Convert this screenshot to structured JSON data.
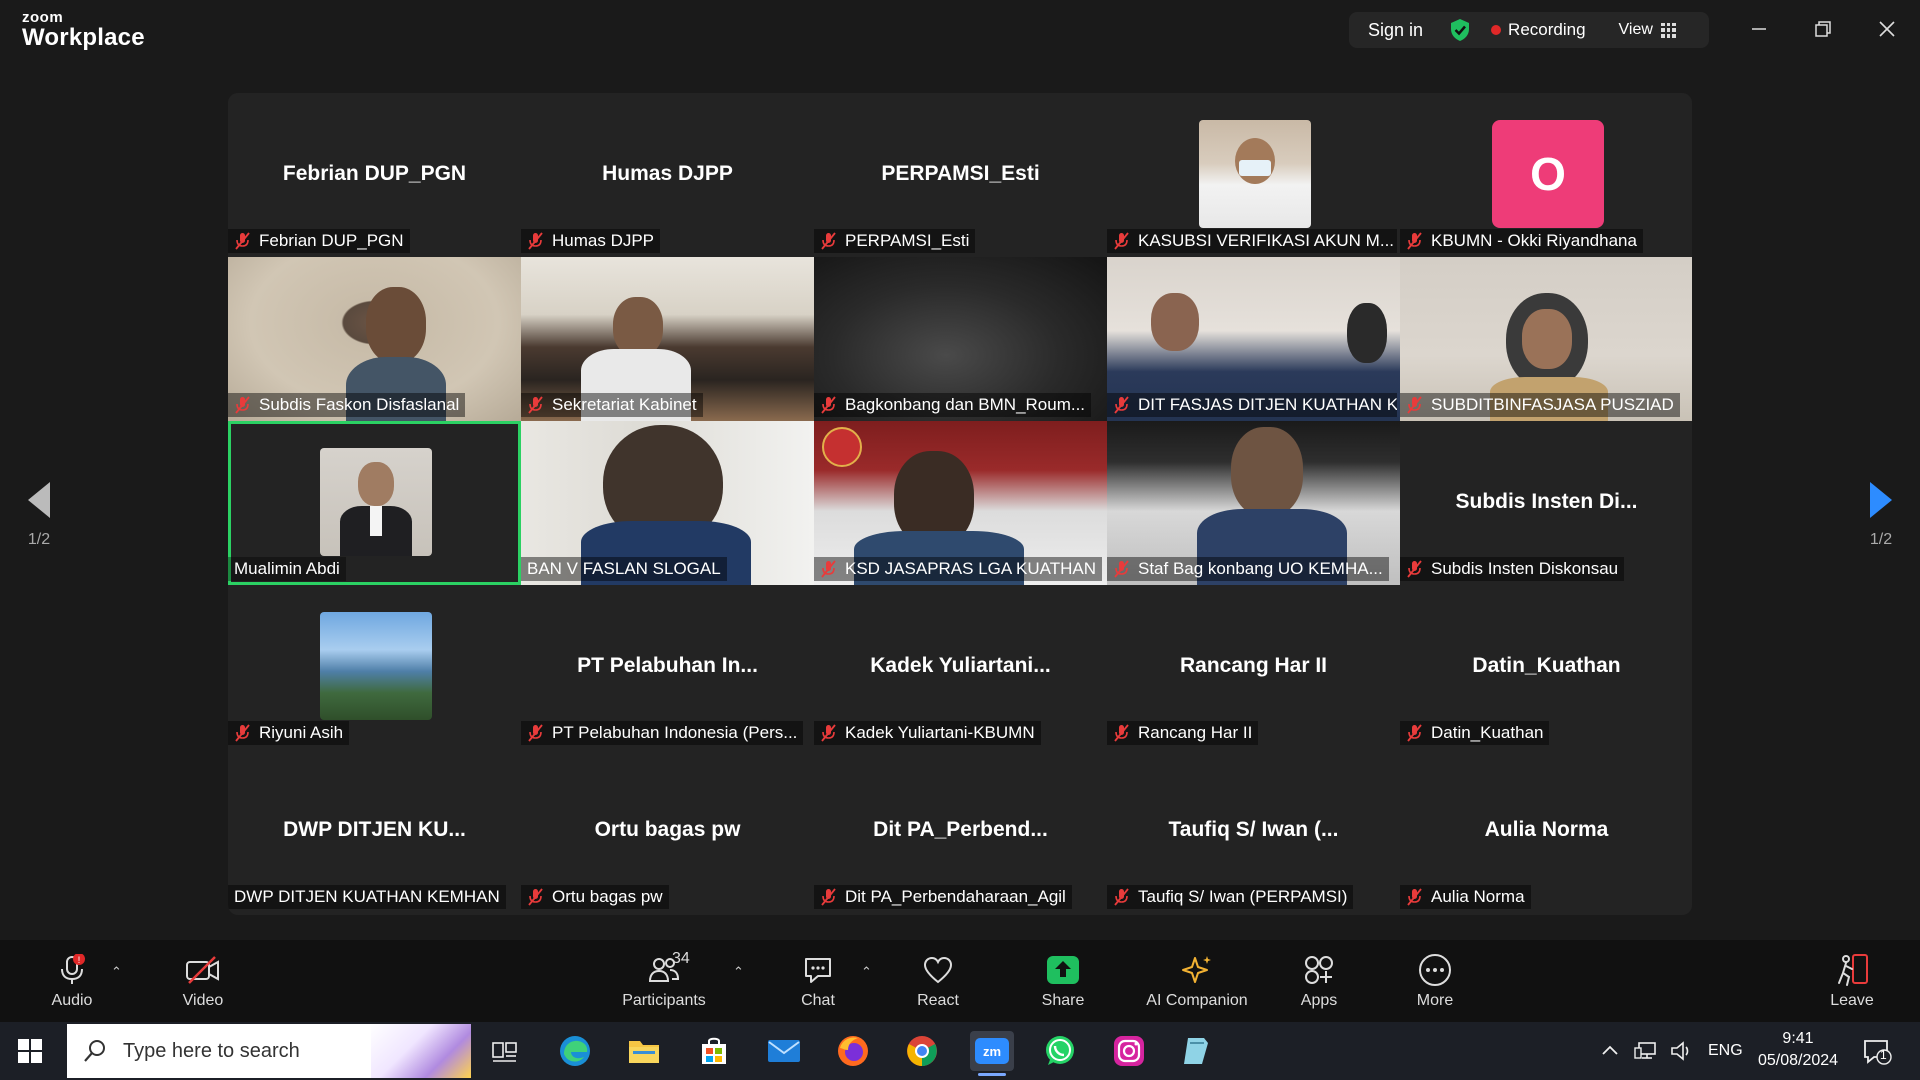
{
  "app": {
    "brand_small": "zoom",
    "brand_large": "Workplace"
  },
  "topbar": {
    "sign_in": "Sign in",
    "recording": "Recording",
    "view": "View"
  },
  "pagination": {
    "left": "1/2",
    "right": "1/2"
  },
  "tiles": [
    {
      "big": "Febrian DUP_PGN",
      "label": "Febrian DUP_PGN",
      "muted": true
    },
    {
      "big": "Humas DJPP",
      "label": "Humas DJPP",
      "muted": true
    },
    {
      "big": "PERPAMSI_Esti",
      "label": "PERPAMSI_Esti",
      "muted": true
    },
    {
      "big": "",
      "label": "KASUBSI VERIFIKASI AKUN M...",
      "muted": true
    },
    {
      "big": "",
      "avatar_letter": "O",
      "label": "KBUMN - Okki Riyandhana",
      "muted": true
    },
    {
      "big": "",
      "label": "Subdis Faskon Disfaslanal",
      "muted": true
    },
    {
      "big": "",
      "label": "Sekretariat Kabinet",
      "muted": true
    },
    {
      "big": "",
      "label": "Bagkonbang dan BMN_Roum...",
      "muted": true
    },
    {
      "big": "",
      "label": "DIT FASJAS DITJEN KUATHAN KE...",
      "muted": true
    },
    {
      "big": "",
      "label": "SUBDITBINFASJASA PUSZIAD",
      "muted": true
    },
    {
      "big": "",
      "label": "Mualimin Abdi",
      "muted": false
    },
    {
      "big": "",
      "label": "BAN V FASLAN SLOGAL",
      "muted": false
    },
    {
      "big": "",
      "label": "KSD JASAPRAS LGA KUATHAN",
      "muted": true
    },
    {
      "big": "",
      "label": "Staf Bag konbang UO KEMHA...",
      "muted": true
    },
    {
      "big": "Subdis Insten Di...",
      "label": "Subdis Insten Diskonsau",
      "muted": true
    },
    {
      "big": "",
      "label": "Riyuni Asih",
      "muted": true
    },
    {
      "big": "PT Pelabuhan In...",
      "label": "PT Pelabuhan Indonesia (Pers...",
      "muted": true
    },
    {
      "big": "Kadek Yuliartani...",
      "label": "Kadek Yuliartani-KBUMN",
      "muted": true
    },
    {
      "big": "Rancang Har II",
      "label": "Rancang Har II",
      "muted": true
    },
    {
      "big": "Datin_Kuathan",
      "label": "Datin_Kuathan",
      "muted": true
    },
    {
      "big": "DWP DITJEN KU...",
      "label": "DWP DITJEN KUATHAN KEMHAN",
      "muted": false
    },
    {
      "big": "Ortu bagas pw",
      "label": "Ortu bagas pw",
      "muted": true
    },
    {
      "big": "Dit PA_Perbend...",
      "label": "Dit PA_Perbendaharaan_Agil",
      "muted": true
    },
    {
      "big": "Taufiq S/ Iwan (...",
      "label": "Taufiq S/ Iwan (PERPAMSI)",
      "muted": true
    },
    {
      "big": "Aulia Norma",
      "label": "Aulia Norma",
      "muted": true
    }
  ],
  "toolbar": {
    "audio": "Audio",
    "video": "Video",
    "participants": "Participants",
    "participants_count": "34",
    "chat": "Chat",
    "react": "React",
    "share": "Share",
    "ai_companion": "AI Companion",
    "apps": "Apps",
    "more": "More",
    "leave": "Leave"
  },
  "taskbar": {
    "search_placeholder": "Type here to search",
    "lang": "ENG",
    "time": "9:41",
    "date": "05/08/2024",
    "notifications": "1"
  },
  "colors": {
    "active_speaker": "#2bd163",
    "muted_red": "#e83b3b",
    "share_green": "#1fbf5f",
    "avatar_pink": "#ee3c78"
  }
}
